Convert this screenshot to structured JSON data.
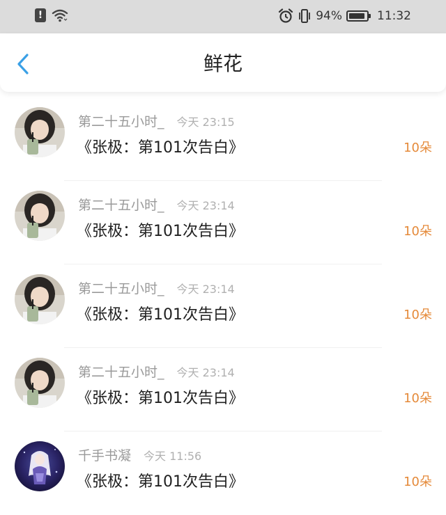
{
  "status_bar": {
    "battery": "94%",
    "time": "11:32"
  },
  "header": {
    "title": "鲜花",
    "back_icon": "chevron-left-icon"
  },
  "colors": {
    "accent": "#3aa0e6",
    "flower_count": "#e58a3a",
    "status_bar_bg": "#dcdcdc"
  },
  "items": [
    {
      "username": "第二十五小时_",
      "time": "今天 23:15",
      "title": "《张极：第101次告白》",
      "count": "10朵",
      "avatar": "photo-avatar"
    },
    {
      "username": "第二十五小时_",
      "time": "今天 23:14",
      "title": "《张极：第101次告白》",
      "count": "10朵",
      "avatar": "photo-avatar"
    },
    {
      "username": "第二十五小时_",
      "time": "今天 23:14",
      "title": "《张极：第101次告白》",
      "count": "10朵",
      "avatar": "photo-avatar"
    },
    {
      "username": "第二十五小时_",
      "time": "今天 23:14",
      "title": "《张极：第101次告白》",
      "count": "10朵",
      "avatar": "photo-avatar"
    },
    {
      "username": "千手书凝",
      "time": "今天 11:56",
      "title": "《张极：第101次告白》",
      "count": "10朵",
      "avatar": "anime-avatar"
    }
  ]
}
